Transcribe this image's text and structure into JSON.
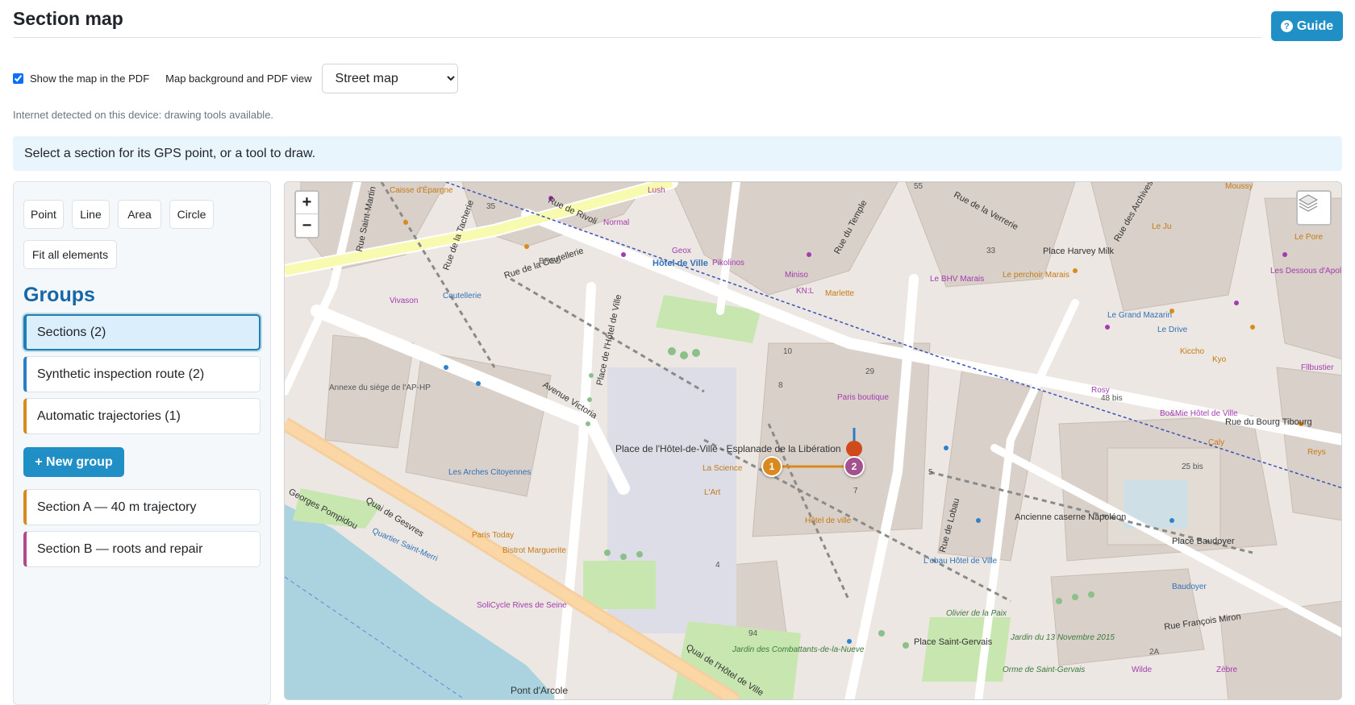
{
  "header": {
    "title": "Section map",
    "guide_label": "Guide"
  },
  "options": {
    "show_map_label": "Show the map in the PDF",
    "show_map_checked": true,
    "background_label": "Map background and PDF view",
    "background_value": "Street map"
  },
  "status_note": "Internet detected on this device: drawing tools available.",
  "info": "Select a section for its GPS point, or a tool to draw.",
  "tools": {
    "point": "Point",
    "line": "Line",
    "area": "Area",
    "circle": "Circle",
    "fit": "Fit all elements"
  },
  "groups": {
    "title": "Groups",
    "items": [
      {
        "label": "Sections (2)",
        "color": "#1f7fb3"
      },
      {
        "label": "Synthetic inspection route (2)",
        "color": "#2a7fc4"
      },
      {
        "label": "Automatic trajectories (1)",
        "color": "#d98a1f"
      }
    ],
    "new_group_label": "+ New group"
  },
  "sections": [
    {
      "label": "Section A — 40 m trajectory",
      "color": "#d98a1f"
    },
    {
      "label": "Section B — roots and repair",
      "color": "#b04a8a"
    }
  ],
  "map": {
    "zoom_in": "+",
    "zoom_out": "−",
    "markers": [
      {
        "label": "1",
        "color": "#d98a1f"
      },
      {
        "label": "2",
        "color": "#a3528f"
      }
    ],
    "streets": [
      "Rue de Rivoli",
      "Rue de la Coutellerie",
      "Rue Saint-Martin",
      "Rue de la Tacherie",
      "Avenue Victoria",
      "Quai de Gesvres",
      "Georges Pompidou",
      "Place de l'Hôtel de Ville",
      "Rue du Temple",
      "Rue de la Verrerie",
      "Rue de Lobau",
      "Rue François Miron",
      "Quai de l'Hôtel de Ville",
      "Quartier Saint-Merri",
      "Rue des Archives"
    ],
    "places": [
      "Place de l'Hôtel-de-Ville - Esplanade de la Libération",
      "Hôtel de Ville",
      "Place Harvey Milk",
      "Rue du Bourg Tibourg",
      "Ancienne caserne Napoléon",
      "Place Baudoyer",
      "Place Saint-Gervais",
      "Pont d'Arcole",
      "Annexe du siège de l'AP-HP"
    ],
    "pois": [
      "Caisse d'Épargne",
      "Lush",
      "Normal",
      "Geox",
      "Pikolinos",
      "Miniso",
      "Marlette",
      "Le BHV Marais",
      "Le perchoir Marais",
      "KN:L",
      "Le Ju",
      "Les Dessous d'Apollon",
      "Le Grand Mazarin",
      "Le Drive",
      "Kiccho",
      "Kyo",
      "Fllbustier",
      "Rosy",
      "Bo&Mie Hôtel de Ville",
      "Caly",
      "Reys",
      "Paris boutique",
      "La Science",
      "L'Art",
      "Hôtel de ville",
      "Les Arches Citoyennes",
      "Paris Today",
      "Bistrot Marguerite",
      "SoliCycle Rives de Seine",
      "Vivason",
      "Coutellerie",
      "BRED",
      "L'obau Hôtel de Ville",
      "Olivier de la Paix",
      "Jardin des Combattants-de-la-Nueve",
      "Jardin du 13 Novembre 2015",
      "Orme de Saint-Gervais",
      "Wilde",
      "Zèbre",
      "Baudoyer",
      "Moussy",
      "Le Pore"
    ],
    "numbers": [
      "55",
      "29",
      "33",
      "35",
      "48 bis",
      "25 bis",
      "94",
      "10",
      "8",
      "7",
      "5",
      "4",
      "2A"
    ]
  }
}
